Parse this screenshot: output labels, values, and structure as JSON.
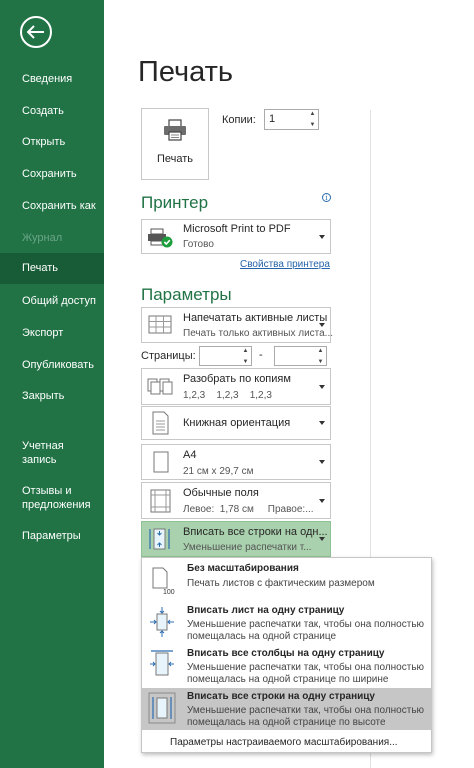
{
  "sidebar": {
    "items": [
      {
        "label": "Сведения"
      },
      {
        "label": "Создать"
      },
      {
        "label": "Открыть"
      },
      {
        "label": "Сохранить"
      },
      {
        "label": "Сохранить как"
      },
      {
        "label": "Журнал"
      },
      {
        "label": "Печать"
      },
      {
        "label": "Общий доступ"
      },
      {
        "label": "Экспорт"
      },
      {
        "label": "Опубликовать"
      },
      {
        "label": "Закрыть"
      },
      {
        "label": "Учетная\nзапись"
      },
      {
        "label": "Отзывы и\nпредложения"
      },
      {
        "label": "Параметры"
      }
    ],
    "active_item": "Печать",
    "disabled_item": "Журнал"
  },
  "main": {
    "title": "Печать",
    "print_button_label": "Печать",
    "copies_label": "Копии:",
    "copies_value": "1",
    "printer_heading": "Принтер",
    "printer": {
      "name": "Microsoft Print to PDF",
      "status": "Готово"
    },
    "printer_properties_link": "Свойства принтера",
    "settings_heading": "Параметры",
    "print_what": {
      "title": "Напечатать активные листы",
      "sub": "Печать только активных листа..."
    },
    "pages_label": "Страницы:",
    "pages_dash": "-",
    "collation": {
      "title": "Разобрать по копиям",
      "sub": "1,2,3    1,2,3    1,2,3"
    },
    "orientation": {
      "title": "Книжная ориентация"
    },
    "paper": {
      "title": "A4",
      "sub": "21 см x 29,7 см"
    },
    "margins": {
      "title": "Обычные поля",
      "sub": "Левое:  1,78 см     Правое:..."
    },
    "scaling": {
      "title": "Вписать все строки на одн...",
      "sub": "Уменьшение распечатки т..."
    }
  },
  "scaling_menu": {
    "options": [
      {
        "title": "Без масштабирования",
        "desc1": "Печать листов с фактическим размером",
        "desc2": ""
      },
      {
        "title": "Вписать лист на одну страницу",
        "desc1": "Уменьшение распечатки так, чтобы она полностью",
        "desc2": "помещалась на одной странице"
      },
      {
        "title": "Вписать все столбцы на одну страницу",
        "desc1": "Уменьшение распечатки так, чтобы она полностью",
        "desc2": "помещалась на одной странице по ширине"
      },
      {
        "title": "Вписать все строки на одну страницу",
        "desc1": "Уменьшение распечатки так, чтобы она полностью",
        "desc2": "помещалась на одной странице по высоте"
      }
    ],
    "custom_link": "Параметры настраиваемого масштабирования..."
  },
  "colors": {
    "sidebar": "#217346",
    "sidebar_active": "#185c37",
    "accent": "#217346",
    "selected_dropdown": "#aad1ae",
    "menu_hover": "#c6c6c6",
    "link": "#2463a8"
  },
  "icons": [
    "back-arrow-icon",
    "printer-icon",
    "pdf-printer-icon",
    "sheets-icon",
    "collate-icon",
    "portrait-page-icon",
    "paper-size-icon",
    "margins-icon",
    "fit-rows-icon",
    "no-scaling-icon",
    "fit-sheet-icon",
    "fit-columns-icon",
    "info-icon"
  ]
}
